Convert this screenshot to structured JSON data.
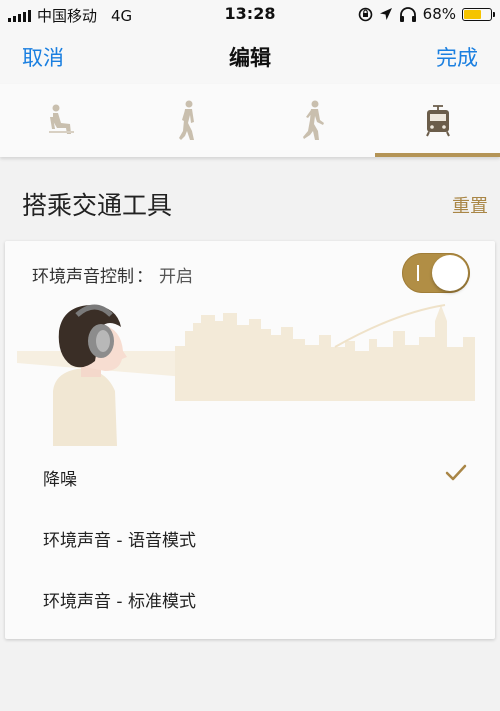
{
  "status_bar": {
    "carrier": "中国移动",
    "network": "4G",
    "time": "13:28",
    "battery_percent": "68%",
    "battery_level": 0.68,
    "icons": [
      "signal-icon",
      "rotation-lock-icon",
      "location-arrow-icon",
      "headphones-icon",
      "battery-icon"
    ]
  },
  "nav": {
    "cancel": "取消",
    "title": "编辑",
    "done": "完成",
    "accent_color": "#1a7fe0"
  },
  "activity_tabs": [
    {
      "icon": "sitting-person-icon",
      "active": false
    },
    {
      "icon": "walking-person-icon",
      "active": false
    },
    {
      "icon": "running-person-icon",
      "active": false
    },
    {
      "icon": "tram-icon",
      "active": true
    }
  ],
  "section": {
    "title": "搭乘交通工具",
    "reset": "重置"
  },
  "ambient_sound": {
    "label": "环境声音控制",
    "separator": "：",
    "state": "开启",
    "toggle_on": true,
    "toggle_color": "#b18e45"
  },
  "modes": [
    {
      "label": "降噪",
      "selected": true
    },
    {
      "label": "环境声音 - 语音模式",
      "selected": false
    },
    {
      "label": "环境声音 - 标准模式",
      "selected": false
    }
  ],
  "colors": {
    "gold_accent": "#b49456"
  }
}
